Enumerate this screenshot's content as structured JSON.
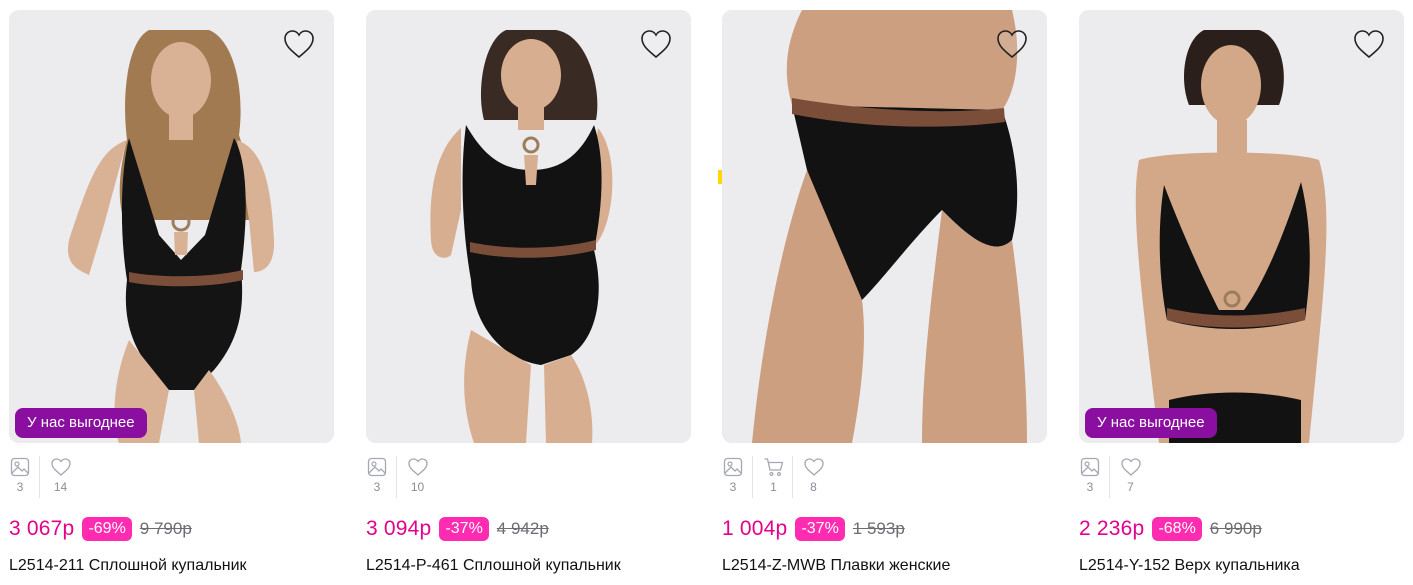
{
  "colors": {
    "price": "#e3008c",
    "discount_bg": "#ff2bb0",
    "badge_bg": "#8a0fa0",
    "photo_bg": "#ecebee",
    "stat_text": "#8b8d99"
  },
  "products": [
    {
      "badge": "У нас выгоднее",
      "stats": {
        "photos": "3",
        "likes": "14"
      },
      "price": "3 067р",
      "discount": "-69%",
      "old_price": "9 790р",
      "title": "L2514-211 Сплошной купальник"
    },
    {
      "stats": {
        "photos": "3",
        "likes": "10"
      },
      "price": "3 094р",
      "discount": "-37%",
      "old_price": "4 942р",
      "title": "L2514-P-461 Сплошной купальник"
    },
    {
      "stats": {
        "photos": "3",
        "cart": "1",
        "likes": "8"
      },
      "price": "1 004р",
      "discount": "-37%",
      "old_price": "1 593р",
      "title": "L2514-Z-MWB Плавки женские"
    },
    {
      "badge": "У нас выгоднее",
      "stats": {
        "photos": "3",
        "likes": "7"
      },
      "price": "2 236р",
      "discount": "-68%",
      "old_price": "6 990р",
      "title": "L2514-Y-152 Верх купальника"
    }
  ]
}
